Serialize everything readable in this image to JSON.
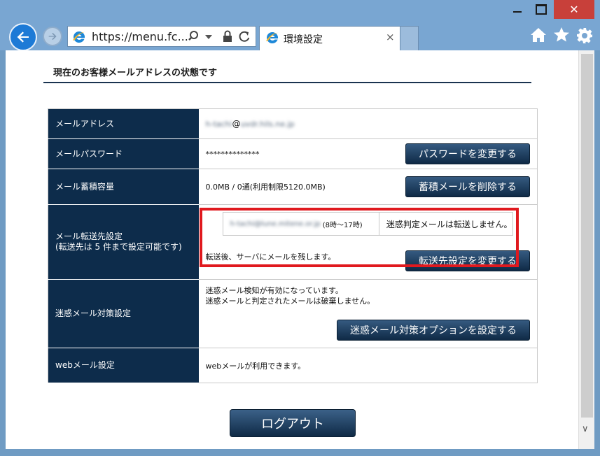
{
  "window": {
    "close_glyph": "✕"
  },
  "address_bar": {
    "url": "https://menu.fc..."
  },
  "tab": {
    "title": "環境設定",
    "close_glyph": "×"
  },
  "icons": {
    "back": "arrow-left",
    "forward": "arrow-right",
    "ie_logo": "ie-e",
    "search": "magnifier",
    "dropdown": "triangle-down",
    "lock": "padlock",
    "refresh": "circular-arrow",
    "home": "house",
    "favorites": "star",
    "settings": "gear"
  },
  "colors": {
    "header_cell": "#0d2c4b",
    "button": "#1e3d5e",
    "highlight_box": "#e0191e",
    "chrome": "#79a6d2"
  },
  "page": {
    "section_title": "現在のお客様メールアドレスの状態です",
    "rows": {
      "address": {
        "label": "メールアドレス",
        "value_user": "h-tachi",
        "value_at": "@",
        "value_domain": "uvdr.hils.ne.jp"
      },
      "password": {
        "label": "メールパスワード",
        "value": "**************",
        "button": "パスワードを変更する"
      },
      "storage": {
        "label": "メール蓄積容量",
        "value": "0.0MB / 0通(利用制限5120.0MB)",
        "button": "蓄積メールを削除する"
      },
      "forwarding": {
        "label_line1": "メール転送先設定",
        "label_line2": "(転送先は 5 件まで設定可能です)",
        "forward_address": "h-tachi@lune.mitene.or.jp",
        "forward_hours": "(8時〜17時)",
        "spam_note": "迷惑判定メールは転送しません。",
        "keep_note": "転送後、サーバにメールを残します。",
        "button": "転送先設定を変更する"
      },
      "spam": {
        "label": "迷惑メール対策設定",
        "line1": "迷惑メール検知が有効になっています。",
        "line2": "迷惑メールと判定されたメールは破棄しません。",
        "button": "迷惑メール対策オプションを設定する"
      },
      "webmail": {
        "label": "webメール設定",
        "value": "webメールが利用できます。"
      }
    },
    "logout_button": "ログアウト"
  },
  "scrollbar": {
    "down_glyph": "∨"
  }
}
